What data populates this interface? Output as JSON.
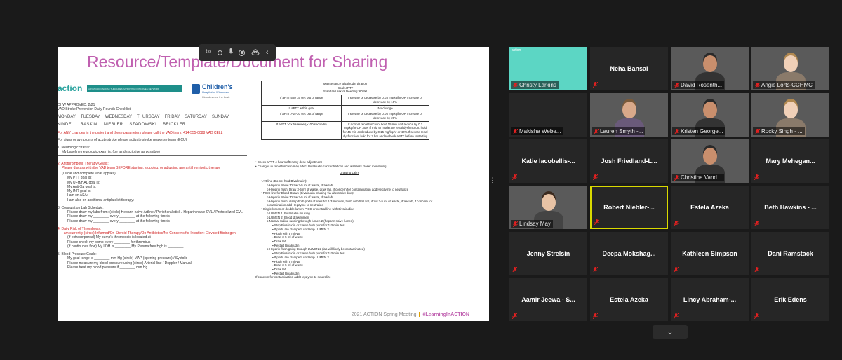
{
  "share": {
    "title": "Resource/Template/Document for Sharing",
    "footer_meeting": "2021 ACTION Spring Meeting",
    "footer_tag": "#LearningInACTION"
  },
  "annotation_toolbar": {
    "tools": [
      "pointer-icon",
      "circle-icon",
      "mic-icon",
      "record-icon",
      "stamp-icon",
      "chevron-left-icon"
    ]
  },
  "doc_left": {
    "logo_action": "action",
    "logo_band": "ADVANCED CARDIAC THERAPIES IMPROVING OUTCOMES NETWORK",
    "hospital_name": "Children's",
    "hospital_sub": "Hospital of Wisconsin",
    "hospital_tag": "Kids deserve the best.",
    "approved": "CHW APPROVED: 2/21",
    "subtitle": "VAD Stroke Prevention Daily Rounds Checklist",
    "days": [
      "MONDAY",
      "TUESDAY",
      "WEDNESDAY",
      "THURSDAY",
      "FRIDAY",
      "SATURDAY",
      "SUNDAY"
    ],
    "names": [
      "KINDEL",
      "RASKIN",
      "NIEBLER",
      "SZADOWSKI",
      "BRICKLER"
    ],
    "notice": "For ANY changes in the patient and these parameters please call the VAD team: 414-555-0088 VAD CELL",
    "stroke_line": "For signs or symptoms of acute stroke please activate stroke response team (ECU)",
    "s1_title": "1. Neurologic Status:",
    "s1_line": "My baseline neurologic exam is: (be as descriptive as possible)",
    "s2_title": "2. Antithrombotic Therapy Goals:",
    "s2_red": "Please discuss with the VAD team BEFORE starting, stopping, or adjusting any antithrombotic therapy",
    "s2_circle": "(Circle and complete what applies)",
    "s2_items": [
      "My PTT goal is:",
      "My UFH/HAL goal is:",
      "My Anti-Xa goal is:",
      "My INR goal is:",
      "I am on ASA:",
      "I am also on additional antiplatelet therapy:"
    ],
    "s3_title": "3. Coagulation Lab Schedule:",
    "s3_items": [
      "Please draw my labs from: (circle) Heparin naive Artline / Peripheral stick / Heparin naive CVL / Protocolized CVL",
      "Please draw my ________ every ________ at the following time/s",
      "Please draw my ________ every ________ at the following time/s"
    ],
    "s4_title": "4. Daily Risk of Thrombosis:",
    "s4_red": "I am currently (circle) Inflamed/On Steroid Therapy/On Antibiotics/No Concerns for Infection: Elevated fibrinogen",
    "s4_items": [
      "(If extracorporeal) My pump's thrombosis is located at",
      "Please check my pump every ________ for thrombus",
      "(If continuous flow) My LDH is ________ My Plasma free Hgb is ________"
    ],
    "s5_title": "5. Blood Pressure Goals:",
    "s5_items": [
      "My goal range is ________ mm Hg (circle) MAP (opening pressure) / Systolic",
      "Please measure my blood pressure using (circle) Arterial line / Doppler / Manual",
      "Please treat my blood pressure if ________ mm Hg"
    ]
  },
  "doc_right": {
    "table_header": [
      "Maintenance Bivalirudin titration",
      "Goal: aPTT",
      "Standard risk of bleeding: 60-90"
    ],
    "table_rows": [
      [
        "If aPTT 5 to 15 sec out of range",
        "Increase or decrease by 0.03 mg/kg/hr OR Increase or decrease by 10%"
      ],
      [
        "If aPTT within goal",
        "No change"
      ],
      [
        "If aPTT >15-30 sec out of range",
        "Increase or decrease by 0.05 mg/kg/hr OR Increase or decrease by 20%"
      ],
      [
        "If aPTT >3x baseline (~100 seconds)",
        "If normal renal function: hold 15 min and reduce by 0.1 mg/kg/hr OR 30% If mild to moderate renal dysfunction: hold for 45 min and reduce by 0.15 mg/kg/hr or 40% If severe renal dysfunction: hold for 2 hrs and recheck aPTT before restarting"
      ]
    ],
    "bullets": [
      "Check aPTT 4 hours after any dose adjustment",
      "Changes in renal function may affect Bivalirudin concentrations and warrants closer monitoring"
    ],
    "drawing_title": "Drawing Lab's",
    "lines": [
      {
        "t": "Art line (Do not hold Bivalirudin):",
        "i": 1
      },
      {
        "t": "Heparin Naive: Draw 3-5 ml of waste, draw lab",
        "i": 2
      },
      {
        "t": "Heparin flush: Draw 3-5 ml of waste, draw lab, if concern for contamination add Hepzyme to neutralize",
        "i": 2
      },
      {
        "t": "PICC line for Blood Draws (Bivalirudin infusing via alternative line):",
        "i": 1
      },
      {
        "t": "Heparin Naive: Draw 3-5 ml of waste, draw lab",
        "i": 2
      },
      {
        "t": "Heparin flush: clamp both ports of lines for 1-3 minutes, flush with 5ml NS, draw 3-5 ml of waste, draw lab, if concern for contamination add Hepzyme to neutralize",
        "i": 2
      },
      {
        "t": "Single lumen or double lumen PICC or central line with Bivalirudin:",
        "i": 1
      },
      {
        "t": "LUMEN 1: Bivalirudin infusing",
        "i": 2
      },
      {
        "t": "LUMEN 2: Blood draw lumen",
        "i": 2
      },
      {
        "t": "Normal Saline running through lumen 2 (heparin naive lumen)",
        "i": 2
      },
      {
        "t": "Stop Bivalirudin or clamp both ports for 1-3 minutes",
        "i": 3
      },
      {
        "t": "If ports are clamped, unclamp LUMEN 2",
        "i": 3
      },
      {
        "t": "Flush with 5 ml NS",
        "i": 3
      },
      {
        "t": "Draw 3-5 ml of waste",
        "i": 3
      },
      {
        "t": "Draw lab",
        "i": 3
      },
      {
        "t": "Restart Bivalirudin",
        "i": 3
      },
      {
        "t": "Heparin flush going through LUMEN 2 (lab will likely be contaminated)",
        "i": 2
      },
      {
        "t": "Stop Bivalirudin or clamp both ports for 1-3 minutes",
        "i": 3
      },
      {
        "t": "If ports are clamped, unclamp LUMEN 2",
        "i": 3
      },
      {
        "t": "Flush with 5 ml NS",
        "i": 3
      },
      {
        "t": "Draw 3-5 ml of waste",
        "i": 3
      },
      {
        "t": "Draw lab",
        "i": 3
      },
      {
        "t": "Restart Bivalirudin",
        "i": 3
      },
      {
        "t": "If concern for contamination add Hepzyme to neutralize",
        "i": 0
      }
    ]
  },
  "gallery": {
    "participants": [
      {
        "name": "Christy Larkins",
        "style": "teal",
        "overlay": "action"
      },
      {
        "name": "Neha Bansal",
        "style": "name"
      },
      {
        "name": "David Rosenth...",
        "style": "video"
      },
      {
        "name": "Angie Lorts-CCHMC",
        "style": "video"
      },
      {
        "name": "Makisha Webe...",
        "style": "dark"
      },
      {
        "name": "Lauren Smyth -...",
        "style": "video"
      },
      {
        "name": "Kristen George...",
        "style": "video"
      },
      {
        "name": "Rocky Singh - ...",
        "style": "video"
      },
      {
        "name": "Katie Iacobellis-...",
        "style": "name"
      },
      {
        "name": "Josh Friedland-L...",
        "style": "name"
      },
      {
        "name": "Christina Vand...",
        "style": "video"
      },
      {
        "name": "Mary Mehegan...",
        "style": "name"
      },
      {
        "name": "Lindsay May",
        "style": "video"
      },
      {
        "name": "Robert Niebler-...",
        "style": "name",
        "active": true
      },
      {
        "name": "Estela Azeka",
        "style": "name"
      },
      {
        "name": "Beth Hawkins - ...",
        "style": "name"
      },
      {
        "name": "Jenny Strelsin",
        "style": "name"
      },
      {
        "name": "Deepa Mokshag...",
        "style": "name"
      },
      {
        "name": "Kathleen Simpson",
        "style": "name"
      },
      {
        "name": "Dani Ramstack",
        "style": "name"
      },
      {
        "name": "Aamir Jeewa - S...",
        "style": "name"
      },
      {
        "name": "Estela Azeka",
        "style": "name"
      },
      {
        "name": "Lincy Abraham-...",
        "style": "name"
      },
      {
        "name": "Erik Edens",
        "style": "name"
      }
    ],
    "page_down_icon": "chevron-down-icon"
  },
  "colors": {
    "title": "#c060b0",
    "mute_red": "#e02020",
    "active_border": "#d9d900",
    "teal": "#5cd6c4"
  }
}
